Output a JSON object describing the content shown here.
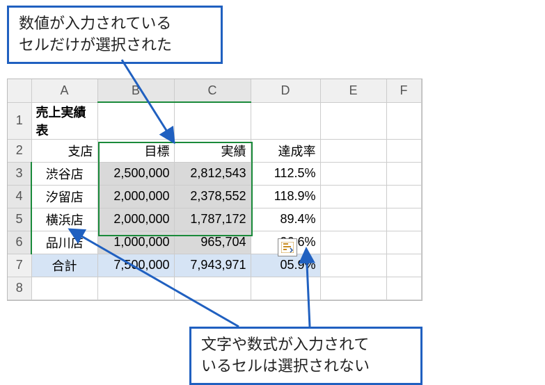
{
  "callouts": {
    "top_line1": "数値が入力されている",
    "top_line2": "セルだけが選択された",
    "bottom_line1": "文字や数式が入力されて",
    "bottom_line2": "いるセルは選択されない"
  },
  "columns": {
    "A": "A",
    "B": "B",
    "C": "C",
    "D": "D",
    "E": "E",
    "F": "F"
  },
  "rows": {
    "r1": "1",
    "r2": "2",
    "r3": "3",
    "r4": "4",
    "r5": "5",
    "r6": "6",
    "r7": "7",
    "r8": "8"
  },
  "title": "売上実績表",
  "headers": {
    "branch": "支店",
    "target": "目標",
    "actual": "実績",
    "rate": "達成率"
  },
  "data": [
    {
      "branch": "渋谷店",
      "target": "2,500,000",
      "actual": "2,812,543",
      "rate": "112.5%"
    },
    {
      "branch": "汐留店",
      "target": "2,000,000",
      "actual": "2,378,552",
      "rate": "118.9%"
    },
    {
      "branch": "横浜店",
      "target": "2,000,000",
      "actual": "1,787,172",
      "rate": "89.4%"
    },
    {
      "branch": "品川店",
      "target": "1,000,000",
      "actual": "965,704",
      "rate": "96.6%"
    }
  ],
  "totals": {
    "label": "合計",
    "target": "7,500,000",
    "actual": "7,943,971",
    "rate": "105.9%",
    "rate_visible": "05.9%"
  },
  "chart_data": {
    "type": "table",
    "title": "売上実績表",
    "columns": [
      "支店",
      "目標",
      "実績",
      "達成率"
    ],
    "rows": [
      [
        "渋谷店",
        2500000,
        2812543,
        1.125
      ],
      [
        "汐留店",
        2000000,
        2378552,
        1.189
      ],
      [
        "横浜店",
        2000000,
        1787172,
        0.894
      ],
      [
        "品川店",
        1000000,
        965704,
        0.966
      ],
      [
        "合計",
        7500000,
        7943971,
        1.059
      ]
    ]
  }
}
